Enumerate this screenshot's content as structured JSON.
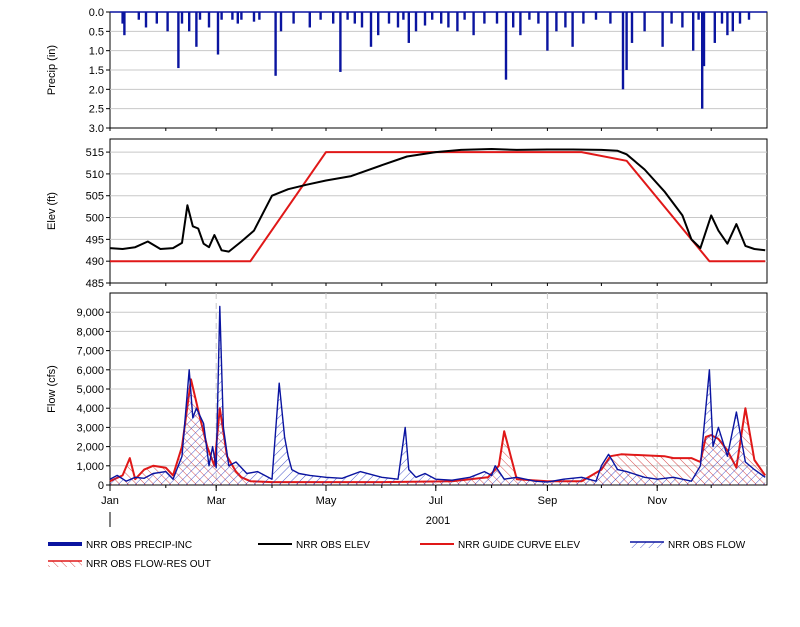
{
  "chart_data": [
    {
      "type": "bar",
      "ylabel": "Precip (in)",
      "ylim": [
        0,
        3.0
      ],
      "inverted": true,
      "y_ticks": [
        "0.0",
        "0.5",
        "1.0",
        "1.5",
        "2.0",
        "2.5",
        "3.0"
      ],
      "series": [
        {
          "name": "NRR OBS PRECIP-INC",
          "color": "#0a14a0",
          "x": [
            "2001-01-08",
            "2001-01-09",
            "2001-01-17",
            "2001-01-21",
            "2001-01-27",
            "2001-02-02",
            "2001-02-08",
            "2001-02-10",
            "2001-02-14",
            "2001-02-18",
            "2001-02-20",
            "2001-02-25",
            "2001-03-02",
            "2001-03-04",
            "2001-03-10",
            "2001-03-13",
            "2001-03-15",
            "2001-03-22",
            "2001-03-25",
            "2001-04-03",
            "2001-04-06",
            "2001-04-13",
            "2001-04-22",
            "2001-04-28",
            "2001-05-05",
            "2001-05-09",
            "2001-05-13",
            "2001-05-17",
            "2001-05-21",
            "2001-05-26",
            "2001-05-30",
            "2001-06-05",
            "2001-06-10",
            "2001-06-13",
            "2001-06-16",
            "2001-06-20",
            "2001-06-25",
            "2001-06-29",
            "2001-07-04",
            "2001-07-08",
            "2001-07-13",
            "2001-07-17",
            "2001-07-22",
            "2001-07-28",
            "2001-08-04",
            "2001-08-09",
            "2001-08-13",
            "2001-08-17",
            "2001-08-22",
            "2001-08-27",
            "2001-09-01",
            "2001-09-06",
            "2001-09-11",
            "2001-09-15",
            "2001-09-21",
            "2001-09-28",
            "2001-10-06",
            "2001-10-13",
            "2001-10-15",
            "2001-10-18",
            "2001-10-25",
            "2001-11-04",
            "2001-11-09",
            "2001-11-15",
            "2001-11-21",
            "2001-11-24",
            "2001-11-26",
            "2001-11-27",
            "2001-12-03",
            "2001-12-07",
            "2001-12-10",
            "2001-12-13",
            "2001-12-17",
            "2001-12-22"
          ],
          "values": [
            0.3,
            0.6,
            0.2,
            0.4,
            0.3,
            0.5,
            1.45,
            0.3,
            0.5,
            0.9,
            0.2,
            0.4,
            1.1,
            0.2,
            0.2,
            0.3,
            0.2,
            0.25,
            0.2,
            1.65,
            0.5,
            0.3,
            0.4,
            0.2,
            0.3,
            1.55,
            0.2,
            0.3,
            0.4,
            0.9,
            0.6,
            0.3,
            0.4,
            0.2,
            0.8,
            0.5,
            0.35,
            0.2,
            0.3,
            0.4,
            0.5,
            0.2,
            0.6,
            0.3,
            0.3,
            1.75,
            0.4,
            0.6,
            0.2,
            0.3,
            1.0,
            0.5,
            0.4,
            0.9,
            0.3,
            0.2,
            0.3,
            2.0,
            1.5,
            0.8,
            0.5,
            0.9,
            0.3,
            0.4,
            1.0,
            0.2,
            2.5,
            1.4,
            0.8,
            0.3,
            0.6,
            0.5,
            0.3,
            0.2
          ]
        }
      ]
    },
    {
      "type": "line",
      "ylabel": "Elev (ft)",
      "ylim": [
        485,
        518
      ],
      "y_ticks": [
        "485",
        "490",
        "495",
        "500",
        "505",
        "510",
        "515"
      ],
      "series": [
        {
          "name": "NRR OBS ELEV",
          "color": "#000000",
          "x": [
            "2001-01-01",
            "2001-01-08",
            "2001-01-15",
            "2001-01-22",
            "2001-01-29",
            "2001-02-05",
            "2001-02-10",
            "2001-02-13",
            "2001-02-16",
            "2001-02-19",
            "2001-02-22",
            "2001-02-25",
            "2001-02-28",
            "2001-03-04",
            "2001-03-08",
            "2001-03-15",
            "2001-03-22",
            "2001-04-01",
            "2001-04-10",
            "2001-04-20",
            "2001-05-01",
            "2001-05-15",
            "2001-06-01",
            "2001-06-15",
            "2001-07-01",
            "2001-07-15",
            "2001-08-01",
            "2001-08-15",
            "2001-09-01",
            "2001-09-15",
            "2001-10-01",
            "2001-10-10",
            "2001-10-15",
            "2001-10-25",
            "2001-11-05",
            "2001-11-15",
            "2001-11-20",
            "2001-11-25",
            "2001-12-01",
            "2001-12-05",
            "2001-12-10",
            "2001-12-15",
            "2001-12-20",
            "2001-12-25",
            "2001-12-31"
          ],
          "y": [
            493.0,
            492.8,
            493.2,
            494.5,
            492.8,
            493.0,
            494.2,
            502.8,
            498.0,
            497.5,
            494.0,
            493.2,
            496.0,
            492.5,
            492.2,
            494.5,
            497.0,
            505.0,
            506.5,
            507.5,
            508.5,
            509.5,
            512.0,
            514.0,
            515.0,
            515.5,
            515.7,
            515.5,
            515.6,
            515.6,
            515.5,
            515.3,
            514.5,
            511.0,
            506.0,
            500.5,
            495.0,
            493.0,
            500.5,
            497.0,
            494.0,
            498.5,
            493.5,
            492.8,
            492.5
          ]
        },
        {
          "name": "NRR GUIDE CURVE ELEV",
          "color": "#e01818",
          "x": [
            "2001-01-01",
            "2001-03-20",
            "2001-05-01",
            "2001-09-20",
            "2001-10-15",
            "2001-11-30",
            "2001-12-31"
          ],
          "y": [
            490,
            490,
            515,
            515,
            513,
            490,
            490
          ]
        }
      ]
    },
    {
      "type": "area",
      "ylabel": "Flow (cfs)",
      "ylim": [
        0,
        10000
      ],
      "y_ticks": [
        "0",
        "1,000",
        "2,000",
        "3,000",
        "4,000",
        "5,000",
        "6,000",
        "7,000",
        "8,000",
        "9,000"
      ],
      "series": [
        {
          "name": "NRR OBS FLOW",
          "color": "#0a14a0",
          "x": [
            "2001-01-01",
            "2001-01-05",
            "2001-01-10",
            "2001-01-15",
            "2001-01-20",
            "2001-01-25",
            "2001-02-01",
            "2001-02-05",
            "2001-02-10",
            "2001-02-14",
            "2001-02-16",
            "2001-02-18",
            "2001-02-22",
            "2001-02-25",
            "2001-02-27",
            "2001-03-01",
            "2001-03-03",
            "2001-03-05",
            "2001-03-08",
            "2001-03-12",
            "2001-03-18",
            "2001-03-24",
            "2001-04-01",
            "2001-04-05",
            "2001-04-08",
            "2001-04-10",
            "2001-04-12",
            "2001-04-16",
            "2001-04-22",
            "2001-05-01",
            "2001-05-10",
            "2001-05-20",
            "2001-06-01",
            "2001-06-10",
            "2001-06-14",
            "2001-06-16",
            "2001-06-20",
            "2001-06-25",
            "2001-07-01",
            "2001-07-10",
            "2001-07-20",
            "2001-07-28",
            "2001-08-01",
            "2001-08-03",
            "2001-08-08",
            "2001-08-15",
            "2001-08-25",
            "2001-09-01",
            "2001-09-10",
            "2001-09-20",
            "2001-09-28",
            "2001-10-01",
            "2001-10-05",
            "2001-10-10",
            "2001-10-15",
            "2001-10-25",
            "2001-11-01",
            "2001-11-10",
            "2001-11-15",
            "2001-11-20",
            "2001-11-25",
            "2001-11-28",
            "2001-11-30",
            "2001-12-02",
            "2001-12-05",
            "2001-12-10",
            "2001-12-15",
            "2001-12-20",
            "2001-12-25",
            "2001-12-31"
          ],
          "y": [
            300,
            500,
            200,
            400,
            350,
            600,
            700,
            300,
            1500,
            6000,
            3500,
            4000,
            3200,
            1000,
            2000,
            900,
            9300,
            3000,
            1000,
            1200,
            600,
            700,
            300,
            5300,
            2500,
            1500,
            800,
            600,
            500,
            400,
            350,
            700,
            400,
            300,
            3000,
            800,
            400,
            600,
            300,
            250,
            400,
            700,
            500,
            1000,
            300,
            400,
            200,
            150,
            300,
            400,
            200,
            1000,
            1600,
            800,
            700,
            400,
            300,
            400,
            300,
            200,
            1000,
            4000,
            6000,
            2000,
            3000,
            1500,
            3800,
            1200,
            800,
            400
          ]
        },
        {
          "name": "NRR OBS FLOW-RES OUT",
          "color": "#e01818",
          "x": [
            "2001-01-01",
            "2001-01-08",
            "2001-01-12",
            "2001-01-15",
            "2001-01-20",
            "2001-01-25",
            "2001-02-01",
            "2001-02-05",
            "2001-02-10",
            "2001-02-15",
            "2001-02-20",
            "2001-02-24",
            "2001-02-28",
            "2001-03-03",
            "2001-03-07",
            "2001-03-12",
            "2001-03-15",
            "2001-03-20",
            "2001-04-01",
            "2001-06-01",
            "2001-07-10",
            "2001-07-30",
            "2001-08-05",
            "2001-08-08",
            "2001-08-15",
            "2001-09-01",
            "2001-09-20",
            "2001-10-01",
            "2001-10-06",
            "2001-10-12",
            "2001-11-05",
            "2001-11-10",
            "2001-11-20",
            "2001-11-25",
            "2001-11-28",
            "2001-12-01",
            "2001-12-05",
            "2001-12-10",
            "2001-12-15",
            "2001-12-20",
            "2001-12-25",
            "2001-12-31"
          ],
          "y": [
            200,
            500,
            1400,
            300,
            800,
            1000,
            900,
            500,
            2000,
            5500,
            3500,
            2000,
            1000,
            4000,
            1500,
            700,
            400,
            200,
            150,
            150,
            200,
            400,
            1000,
            2800,
            300,
            200,
            200,
            800,
            1500,
            1600,
            1500,
            1400,
            1400,
            1200,
            2500,
            2600,
            2400,
            1800,
            900,
            4000,
            1300,
            500
          ]
        }
      ]
    }
  ],
  "x_axis": {
    "tick_labels": [
      "Jan",
      "Mar",
      "May",
      "Jul",
      "Sep",
      "Nov"
    ],
    "year_label": "2001"
  },
  "legend": [
    {
      "name": "NRR OBS PRECIP-INC",
      "color": "#0a14a0",
      "style": "thick"
    },
    {
      "name": "NRR OBS ELEV",
      "color": "#000000",
      "style": "line"
    },
    {
      "name": "NRR GUIDE CURVE ELEV",
      "color": "#e01818",
      "style": "line"
    },
    {
      "name": "NRR OBS FLOW",
      "color": "#0a14a0",
      "style": "hatch"
    },
    {
      "name": "NRR OBS FLOW-RES OUT",
      "color": "#e01818",
      "style": "hatch"
    }
  ]
}
